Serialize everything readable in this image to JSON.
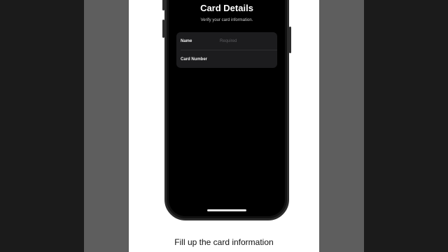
{
  "screen": {
    "title": "Card Details",
    "subtitle": "Verify your card information."
  },
  "form": {
    "name_label": "Name",
    "name_placeholder": "Required",
    "card_number_label": "Card Number"
  },
  "caption": "Fill up the card information"
}
